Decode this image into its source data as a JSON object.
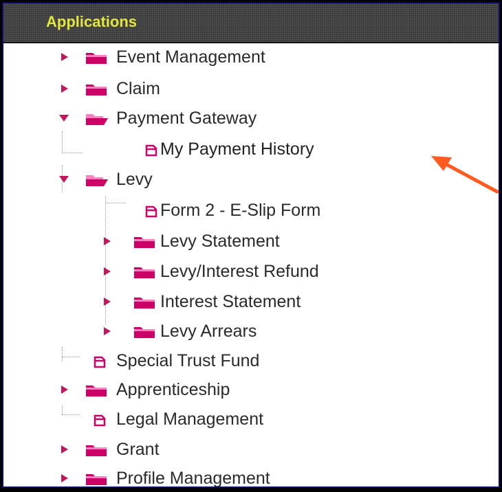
{
  "header": {
    "title": "Applications"
  },
  "tree": {
    "event_management": "Event Management",
    "claim": "Claim",
    "payment_gateway": "Payment Gateway",
    "my_payment_history": "My Payment History",
    "levy": "Levy",
    "form2_eslip": "Form 2 - E-Slip Form",
    "levy_statement": "Levy Statement",
    "levy_interest_refund": "Levy/Interest Refund",
    "interest_statement": "Interest Statement",
    "levy_arrears": "Levy Arrears",
    "special_trust_fund": "Special Trust Fund",
    "apprenticeship": "Apprenticeship",
    "legal_management": "Legal Management",
    "grant": "Grant",
    "profile_management": "Profile Management"
  },
  "colors": {
    "header_text": "#e3e640",
    "folder": "#cc0066",
    "arrow": "#ff5a1f",
    "expander": "#c2185b"
  },
  "icons": {
    "collapsed": "triangle-right-icon",
    "expanded": "triangle-down-icon",
    "folder_closed": "folder-icon",
    "folder_open": "folder-open-icon",
    "page": "page-icon"
  }
}
